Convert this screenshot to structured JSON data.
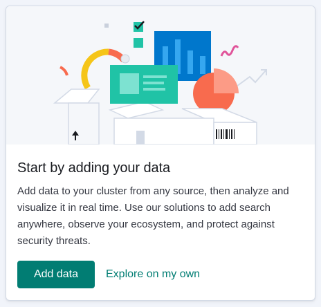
{
  "card": {
    "title": "Start by adding your data",
    "description": "Add data to your cluster from any source, then analyze and visualize it in real time. Use our solutions to add search anywhere, observe your ecosystem, and protect against security threats.",
    "primary_button": "Add data",
    "secondary_link": "Explore on my own"
  },
  "colors": {
    "accent": "#017d73",
    "illustration_blue": "#0077cc",
    "illustration_teal": "#20c3a6",
    "illustration_coral": "#f86b4e",
    "illustration_yellow": "#f5c518",
    "illustration_pink": "#e0549a"
  },
  "icons": [
    "checkbox-check-icon",
    "bar-chart-icon",
    "donut-chart-icon",
    "pie-chart-icon",
    "up-arrow-icon",
    "barcode-icon",
    "trend-line-icon",
    "squiggle-icon"
  ]
}
